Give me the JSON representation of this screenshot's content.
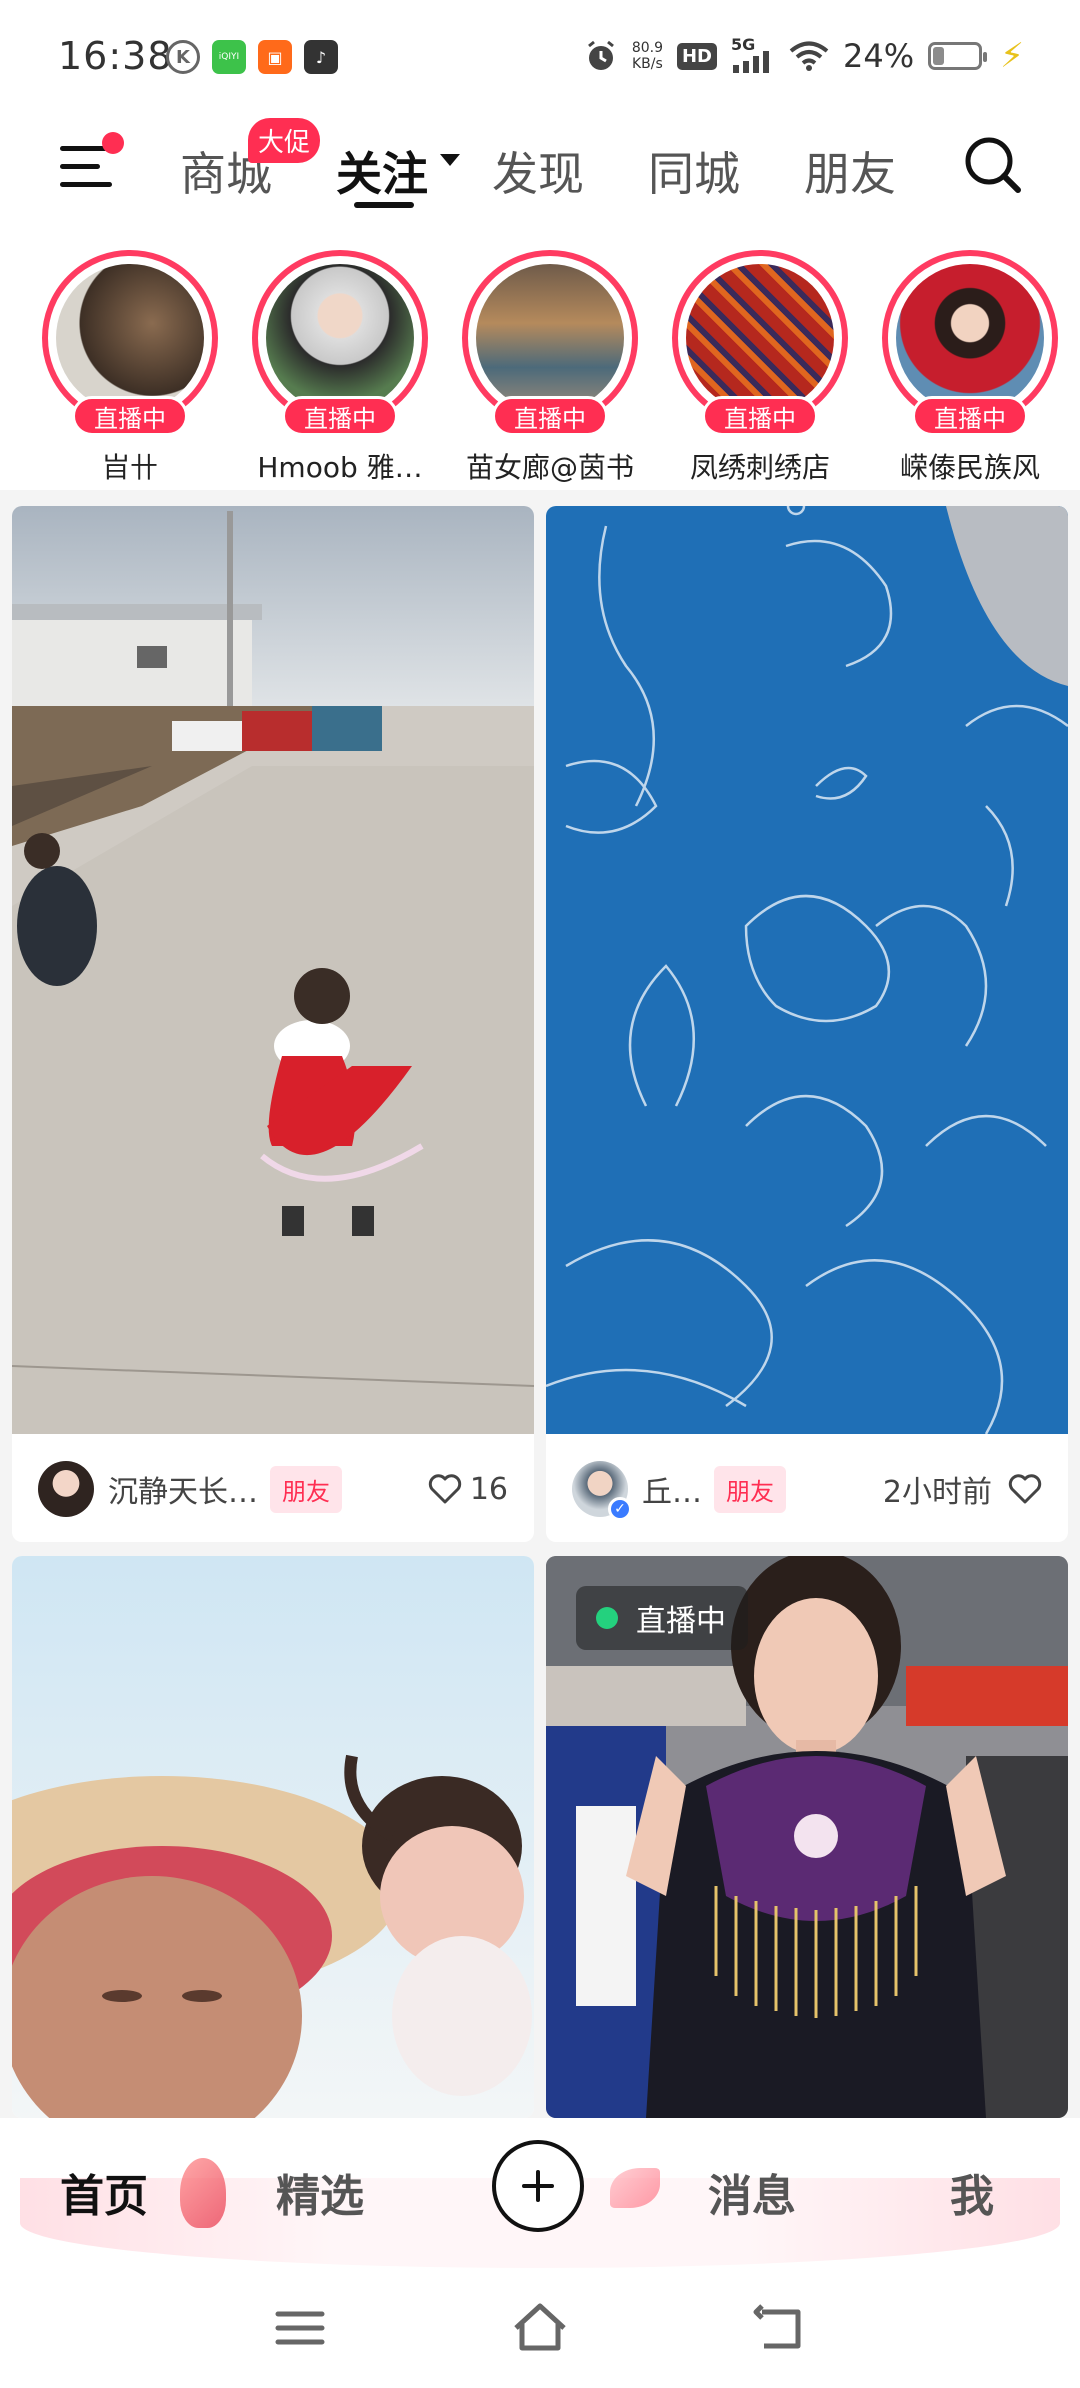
{
  "status_bar": {
    "time": "16:38",
    "net_speed": "80.9",
    "net_speed_unit": "KB/s",
    "hd_label": "HD",
    "signal_label": "5G",
    "battery": "24%",
    "battery_level": 0.24
  },
  "top_nav": {
    "tabs": [
      "商城",
      "关注",
      "发现",
      "同城",
      "朋友"
    ],
    "active_tab": "关注",
    "promo_badge": "大促"
  },
  "stories": [
    {
      "name": "㞱卄",
      "live_label": "直播中"
    },
    {
      "name": "Hmoob 雅…",
      "live_label": "直播中"
    },
    {
      "name": "苗女廊@茵书",
      "live_label": "直播中"
    },
    {
      "name": "凤绣刺绣店",
      "live_label": "直播中"
    },
    {
      "name": "嵘傣民族风",
      "live_label": "直播中"
    }
  ],
  "feed": [
    {
      "author": "沉静天长…",
      "tag": "朋友",
      "likes": "16"
    },
    {
      "author": "丘…",
      "tag": "朋友",
      "time": "2小时前"
    },
    {
      "live_label": "直播中"
    }
  ],
  "bottom_tabs": {
    "home": "首页",
    "featured": "精选",
    "messages": "消息",
    "me": "我"
  },
  "colors": {
    "accent": "#ff2e52",
    "live_green": "#24d17e"
  }
}
